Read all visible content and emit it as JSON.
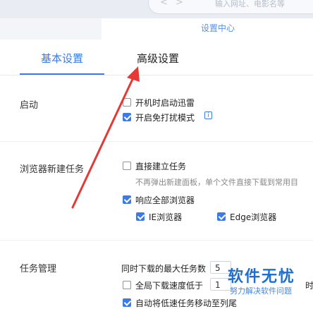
{
  "topbar": {
    "back_icon": "chevron-left-icon",
    "forward_icon": "chevron-right-icon",
    "address_placeholder": "输入网址、电影名等"
  },
  "dialog": {
    "title": "设置中心"
  },
  "tabs": [
    {
      "label": "基本设置",
      "active": true
    },
    {
      "label": "高级设置",
      "active": false
    }
  ],
  "sections": {
    "startup": {
      "label": "启动",
      "options": [
        {
          "label": "开机时启动迅雷",
          "checked": false
        },
        {
          "label": "开启免打扰模式",
          "checked": true
        }
      ]
    },
    "browser": {
      "label": "浏览器新建任务",
      "direct": {
        "label": "直接建立任务",
        "checked": false
      },
      "direct_hint": "不再弹出新建面板，单个文件直接下载到常用目",
      "respond_all": {
        "label": "响应全部浏览器",
        "checked": true
      },
      "ie": {
        "label": "IE浏览器",
        "checked": true
      },
      "edge": {
        "label": "Edge浏览器",
        "checked": true
      }
    },
    "task": {
      "label": "任务管理",
      "max_tasks_label": "同时下载的最大任务数",
      "max_tasks_value": "5",
      "speed_label": "全局下载速度低于",
      "speed_value": "1",
      "speed_tail": "时",
      "auto_move_label": "自动将低速任务移动至列尾",
      "auto_move_checked": true
    }
  },
  "watermark": {
    "main": "软件无忧",
    "sub": "努力解决软件问题"
  },
  "colors": {
    "accent": "#3b7ae8",
    "annotation_arrow": "#e53935"
  }
}
